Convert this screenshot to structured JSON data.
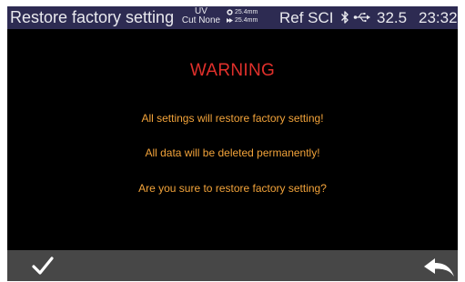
{
  "status_bar": {
    "title": "Restore factory setting",
    "uv_label": "UV",
    "uv_value": "Cut None",
    "aperture_1": "25.4mm",
    "aperture_2": "25.4mm",
    "ref_sci": "Ref SCI",
    "temperature": "32.5",
    "time": "23:32",
    "icons": [
      "bluetooth-icon",
      "usb-icon"
    ]
  },
  "dialog": {
    "heading": "WARNING",
    "lines": [
      "All settings will restore factory setting!",
      "All data will be deleted permanently!",
      "Are you sure to restore factory setting?"
    ]
  },
  "bottom_bar": {
    "confirm_icon": "checkmark-icon",
    "back_icon": "back-arrow-icon"
  },
  "colors": {
    "status_bar_bg": "#2d2b52",
    "screen_bg": "#000000",
    "warning": "#e0302b",
    "message": "#f2a33a",
    "bottom_bar_bg": "#474747"
  }
}
